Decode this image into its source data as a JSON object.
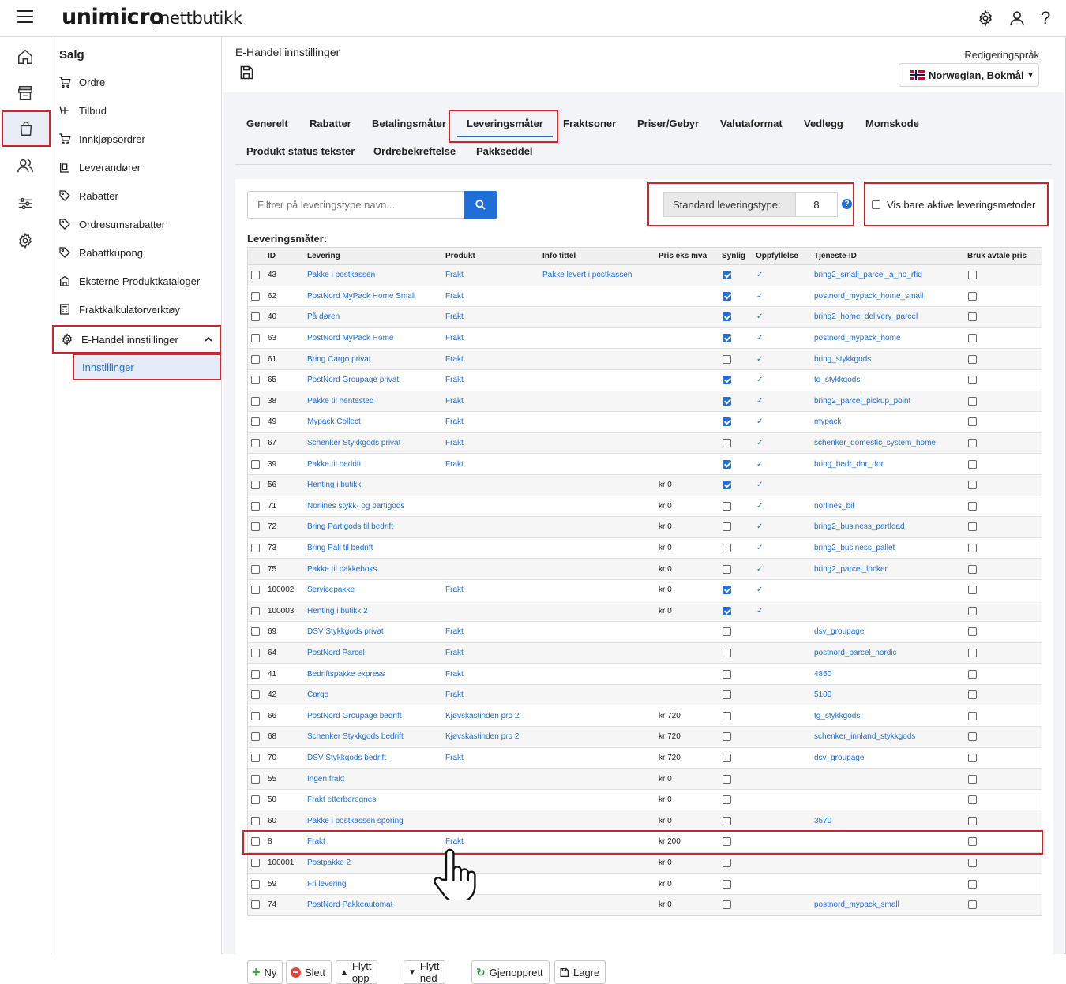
{
  "header": {
    "logo": "unimicro",
    "logo_sub": "nettbutikk",
    "icons": [
      "gear-icon",
      "user-icon",
      "help-icon"
    ]
  },
  "rail": {
    "items": [
      "home-icon",
      "store-icon",
      "shopping-bag-icon",
      "users-icon",
      "sliders-icon",
      "settings-icon"
    ],
    "active": "shopping-bag-icon"
  },
  "subnav": {
    "title": "Salg",
    "items": [
      {
        "label": "Ordre",
        "icon": "cart-icon"
      },
      {
        "label": "Tilbud",
        "icon": "cart-icon"
      },
      {
        "label": "Innkjøpsordrer",
        "icon": "cart-icon"
      },
      {
        "label": "Leverandører",
        "icon": "supplier-icon"
      },
      {
        "label": "Rabatter",
        "icon": "tag-icon"
      },
      {
        "label": "Ordresumsrabatter",
        "icon": "tag-icon"
      },
      {
        "label": "Rabattkupong",
        "icon": "tag-icon"
      },
      {
        "label": "Eksterne Produktkataloger",
        "icon": "catalog-icon"
      },
      {
        "label": "Fraktkalkulatorverktøy",
        "icon": "calculator-icon"
      },
      {
        "label": "E-Handel innstillinger",
        "icon": "gear-icon"
      }
    ],
    "sub_item": "Innstillinger"
  },
  "main": {
    "title": "E-Handel innstillinger",
    "lang_label": "Redigeringspråk",
    "lang_value": "Norwegian, Bokmål"
  },
  "tabs": [
    "Generelt",
    "Rabatter",
    "Betalingsmåter",
    "Leveringsmåter",
    "Fraktsoner",
    "Priser/Gebyr",
    "Valutaformat",
    "Vedlegg",
    "Momskode",
    "Produkt status tekster",
    "Ordrebekreftelse",
    "Pakkseddel"
  ],
  "active_tab": "Leveringsmåter",
  "filter": {
    "placeholder": "Filtrer på leveringstype navn...",
    "std_label": "Standard leveringstype:",
    "std_value": "8",
    "active_only_label": "Vis bare aktive leveringsmetoder"
  },
  "grid": {
    "section_label": "Leveringsmåter:",
    "columns": [
      "ID",
      "Levering",
      "Produkt",
      "Info tittel",
      "Pris eks mva",
      "Synlig",
      "Oppfyllelse",
      "Tjeneste-ID",
      "Bruk avtale pris"
    ],
    "rows": [
      {
        "id": "43",
        "levering": "Pakke i postkassen",
        "produkt": "Frakt",
        "info": "Pakke levert i postkassen",
        "pris": "",
        "synlig": true,
        "oppf": true,
        "tjeneste": "bring2_small_parcel_a_no_rfid"
      },
      {
        "id": "62",
        "levering": "PostNord MyPack Home Small",
        "produkt": "Frakt",
        "info": "",
        "pris": "",
        "synlig": true,
        "oppf": true,
        "tjeneste": "postnord_mypack_home_small"
      },
      {
        "id": "40",
        "levering": "På døren",
        "produkt": "Frakt",
        "info": "",
        "pris": "",
        "synlig": true,
        "oppf": true,
        "tjeneste": "bring2_home_delivery_parcel"
      },
      {
        "id": "63",
        "levering": "PostNord MyPack Home",
        "produkt": "Frakt",
        "info": "",
        "pris": "",
        "synlig": true,
        "oppf": true,
        "tjeneste": "postnord_mypack_home"
      },
      {
        "id": "61",
        "levering": "Bring Cargo privat",
        "produkt": "Frakt",
        "info": "",
        "pris": "",
        "synlig": false,
        "oppf": true,
        "tjeneste": "bring_stykkgods"
      },
      {
        "id": "65",
        "levering": "PostNord Groupage privat",
        "produkt": "Frakt",
        "info": "",
        "pris": "",
        "synlig": true,
        "oppf": true,
        "tjeneste": "tg_stykkgods"
      },
      {
        "id": "38",
        "levering": "Pakke til hentested",
        "produkt": "Frakt",
        "info": "",
        "pris": "",
        "synlig": true,
        "oppf": true,
        "tjeneste": "bring2_parcel_pickup_point"
      },
      {
        "id": "49",
        "levering": "Mypack Collect",
        "produkt": "Frakt",
        "info": "",
        "pris": "",
        "synlig": true,
        "oppf": true,
        "tjeneste": "mypack"
      },
      {
        "id": "67",
        "levering": "Schenker Stykkgods privat",
        "produkt": "Frakt",
        "info": "",
        "pris": "",
        "synlig": false,
        "oppf": true,
        "tjeneste": "schenker_domestic_system_home"
      },
      {
        "id": "39",
        "levering": "Pakke til bedrift",
        "produkt": "Frakt",
        "info": "",
        "pris": "",
        "synlig": true,
        "oppf": true,
        "tjeneste": "bring_bedr_dor_dor"
      },
      {
        "id": "56",
        "levering": "Henting i butikk",
        "produkt": "",
        "info": "",
        "pris": "kr 0",
        "synlig": true,
        "oppf": true,
        "tjeneste": ""
      },
      {
        "id": "71",
        "levering": "Norlines stykk- og partigods",
        "produkt": "",
        "info": "",
        "pris": "kr 0",
        "synlig": false,
        "oppf": true,
        "tjeneste": "norlines_bil"
      },
      {
        "id": "72",
        "levering": "Bring Partigods til bedrift",
        "produkt": "",
        "info": "",
        "pris": "kr 0",
        "synlig": false,
        "oppf": true,
        "tjeneste": "bring2_business_partload"
      },
      {
        "id": "73",
        "levering": "Bring Pall til bedrift",
        "produkt": "",
        "info": "",
        "pris": "kr 0",
        "synlig": false,
        "oppf": true,
        "tjeneste": "bring2_business_pallet"
      },
      {
        "id": "75",
        "levering": "Pakke til pakkeboks",
        "produkt": "",
        "info": "",
        "pris": "kr 0",
        "synlig": false,
        "oppf": true,
        "tjeneste": "bring2_parcel_locker"
      },
      {
        "id": "100002",
        "levering": "Servicepakke",
        "produkt": "Frakt",
        "info": "",
        "pris": "kr 0",
        "synlig": true,
        "oppf": true,
        "tjeneste": ""
      },
      {
        "id": "100003",
        "levering": "Henting i butikk 2",
        "produkt": "",
        "info": "",
        "pris": "kr 0",
        "synlig": true,
        "oppf": true,
        "tjeneste": ""
      },
      {
        "id": "69",
        "levering": "DSV Stykkgods privat",
        "produkt": "Frakt",
        "info": "",
        "pris": "",
        "synlig": false,
        "oppf": false,
        "tjeneste": "dsv_groupage"
      },
      {
        "id": "64",
        "levering": "PostNord Parcel",
        "produkt": "Frakt",
        "info": "",
        "pris": "",
        "synlig": false,
        "oppf": false,
        "tjeneste": "postnord_parcel_nordic"
      },
      {
        "id": "41",
        "levering": "Bedriftspakke express",
        "produkt": "Frakt",
        "info": "",
        "pris": "",
        "synlig": false,
        "oppf": false,
        "tjeneste": "4850"
      },
      {
        "id": "42",
        "levering": "Cargo",
        "produkt": "Frakt",
        "info": "",
        "pris": "",
        "synlig": false,
        "oppf": false,
        "tjeneste": "5100"
      },
      {
        "id": "66",
        "levering": "PostNord Groupage bedrift",
        "produkt": "Kjøvskastinden pro 2",
        "info": "",
        "pris": "kr 720",
        "synlig": false,
        "oppf": false,
        "tjeneste": "tg_stykkgods"
      },
      {
        "id": "68",
        "levering": "Schenker Stykkgods bedrift",
        "produkt": "Kjøvskastinden pro 2",
        "info": "",
        "pris": "kr 720",
        "synlig": false,
        "oppf": false,
        "tjeneste": "schenker_innland_stykkgods"
      },
      {
        "id": "70",
        "levering": "DSV Stykkgods bedrift",
        "produkt": "Frakt",
        "info": "",
        "pris": "kr 720",
        "synlig": false,
        "oppf": false,
        "tjeneste": "dsv_groupage"
      },
      {
        "id": "55",
        "levering": "Ingen frakt",
        "produkt": "",
        "info": "",
        "pris": "kr 0",
        "synlig": false,
        "oppf": false,
        "tjeneste": ""
      },
      {
        "id": "50",
        "levering": "Frakt etterberegnes",
        "produkt": "",
        "info": "",
        "pris": "kr 0",
        "synlig": false,
        "oppf": false,
        "tjeneste": ""
      },
      {
        "id": "60",
        "levering": "Pakke i postkassen sporing",
        "produkt": "",
        "info": "",
        "pris": "kr 0",
        "synlig": false,
        "oppf": false,
        "tjeneste": "3570"
      },
      {
        "id": "8",
        "levering": "Frakt",
        "produkt": "Frakt",
        "info": "",
        "pris": "kr 200",
        "synlig": false,
        "oppf": false,
        "tjeneste": ""
      },
      {
        "id": "100001",
        "levering": "Postpakke 2",
        "produkt": "",
        "info": "",
        "pris": "kr 0",
        "synlig": false,
        "oppf": false,
        "tjeneste": ""
      },
      {
        "id": "59",
        "levering": "Fri levering",
        "produkt": "",
        "info": "",
        "pris": "kr 0",
        "synlig": false,
        "oppf": false,
        "tjeneste": ""
      },
      {
        "id": "74",
        "levering": "PostNord Pakkeautomat",
        "produkt": "",
        "info": "",
        "pris": "kr 0",
        "synlig": false,
        "oppf": false,
        "tjeneste": "postnord_mypack_small"
      }
    ]
  },
  "buttons": [
    {
      "label": "Ny",
      "icon": "plus-icon"
    },
    {
      "label": "Slett",
      "icon": "delete-icon"
    },
    {
      "label": "Flytt opp",
      "icon": "arrow-up-icon"
    },
    {
      "label": "Flytt ned",
      "icon": "arrow-down-icon"
    },
    {
      "label": "Gjenopprett",
      "icon": "restore-icon"
    },
    {
      "label": "Lagre",
      "icon": "save-icon"
    }
  ],
  "colors": {
    "accent": "#1f6fd6",
    "highlight": "#d0232b"
  }
}
